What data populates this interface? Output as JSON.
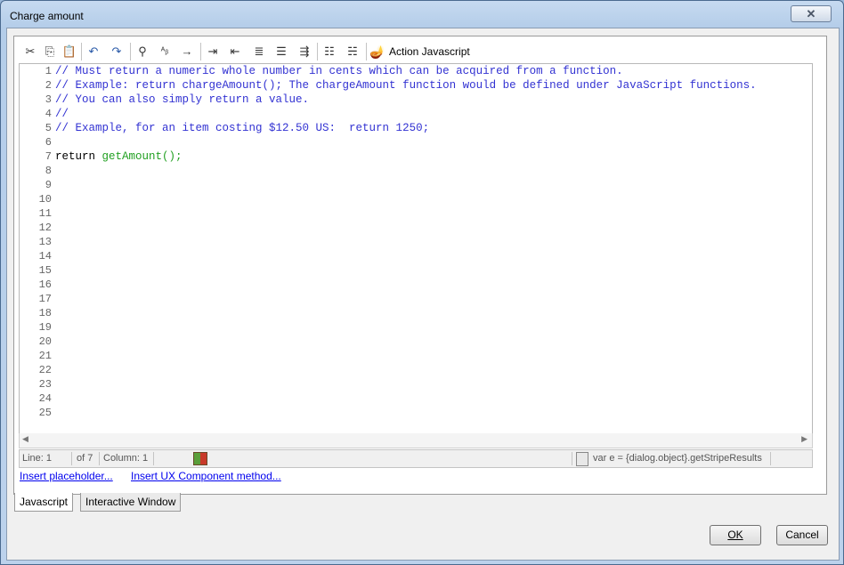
{
  "window": {
    "title": "Charge amount",
    "close_glyph": "✕"
  },
  "toolbar": {
    "buttons": [
      {
        "name": "cut-icon",
        "glyph": "✂"
      },
      {
        "name": "copy-icon",
        "glyph": "⎘"
      },
      {
        "name": "paste-icon",
        "glyph": "📋"
      },
      {
        "name": "undo-icon",
        "glyph": "↶"
      },
      {
        "name": "redo-icon",
        "glyph": "↷"
      },
      {
        "name": "find-icon",
        "glyph": "⚲"
      },
      {
        "name": "replace-icon",
        "glyph": "ᴬᵦ"
      },
      {
        "name": "goto-icon",
        "glyph": "→"
      },
      {
        "name": "indent-icon",
        "glyph": "⇥"
      },
      {
        "name": "outdent-icon",
        "glyph": "⇤"
      },
      {
        "name": "format-icon",
        "glyph": "≣"
      },
      {
        "name": "align-right-icon",
        "glyph": "☰"
      },
      {
        "name": "insert-icon",
        "glyph": "⇶"
      },
      {
        "name": "comment-icon",
        "glyph": "☷"
      },
      {
        "name": "uncomment-icon",
        "glyph": "☵"
      }
    ],
    "action_label": "Action Javascript"
  },
  "editor": {
    "line_numbers": [
      "1",
      "2",
      "3",
      "4",
      "5",
      "6",
      "7",
      "8",
      "9",
      "10",
      "11",
      "12",
      "13",
      "14",
      "15",
      "16",
      "17",
      "18",
      "19",
      "20",
      "21",
      "22",
      "23",
      "24",
      "25"
    ],
    "code": {
      "line1": "// Must return a numeric whole number in cents which can be acquired from a function.",
      "line2": "// Example: return chargeAmount(); The chargeAmount function would be defined under JavaScript functions.",
      "line3": "// You can also simply return a value.",
      "line4": "//",
      "line5": "// Example, for an item costing $12.50 US:  return 1250;",
      "line7_keyword": "return ",
      "line7_call": "getAmount();"
    }
  },
  "status": {
    "line": "Line: 1",
    "of": "of 7",
    "column": "Column: 1",
    "snippet": "var e = {dialog.object}.getStripeResults"
  },
  "links": {
    "insert_placeholder": "Insert placeholder...",
    "insert_ux": "Insert UX Component method..."
  },
  "tabs": {
    "javascript": "Javascript",
    "interactive": "Interactive Window"
  },
  "buttons": {
    "ok": "OK",
    "cancel": "Cancel"
  }
}
